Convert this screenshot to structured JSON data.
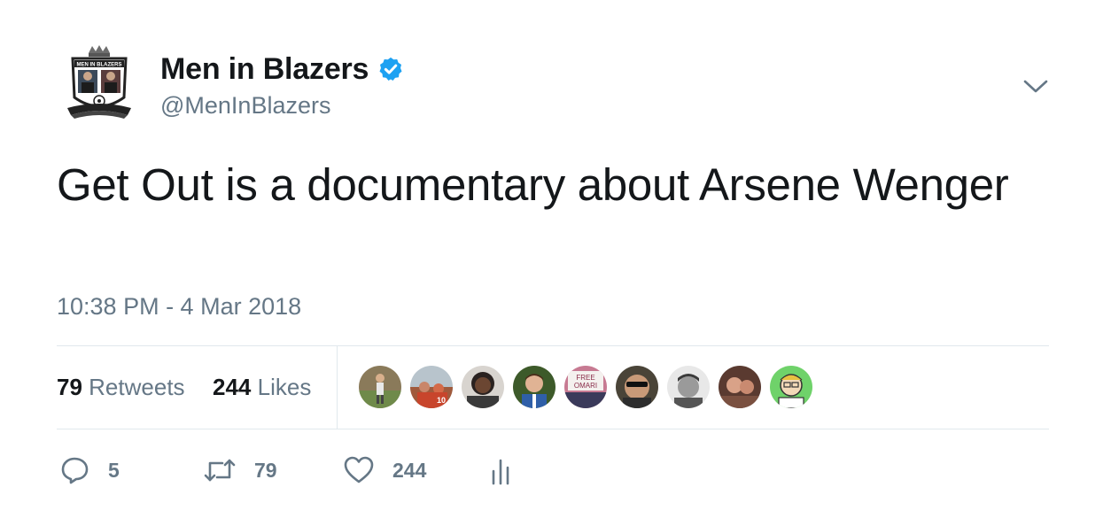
{
  "tweet": {
    "display_name": "Men in Blazers",
    "handle": "@MenInBlazers",
    "text": "Get Out is a documentary about Arsene Wenger",
    "timestamp": "10:38 PM - 4 Mar 2018",
    "avatar_text": "MEN IN BLAZERS",
    "verified_icon": "verified-badge-icon",
    "accent_color": "#1da1f2",
    "stats": {
      "retweets_count": "79",
      "retweets_label": "Retweets",
      "likes_count": "244",
      "likes_label": "Likes"
    },
    "likers": [
      "liker-avatar-1",
      "liker-avatar-2",
      "liker-avatar-3",
      "liker-avatar-4",
      "liker-avatar-5",
      "liker-avatar-6",
      "liker-avatar-7",
      "liker-avatar-8",
      "liker-avatar-9"
    ],
    "liker_5_sign_text": "FREE OMARI",
    "actions": {
      "reply_count": "5",
      "retweet_count": "79",
      "like_count": "244"
    }
  }
}
